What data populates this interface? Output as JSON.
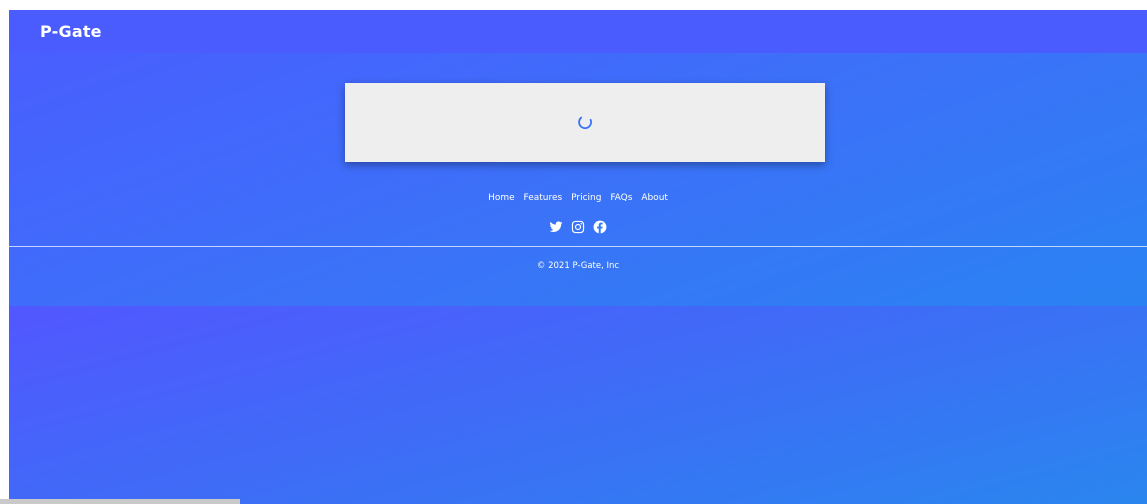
{
  "app": {
    "brand": "P-Gate"
  },
  "footer": {
    "links": [
      {
        "label": "Home"
      },
      {
        "label": "Features"
      },
      {
        "label": "Pricing"
      },
      {
        "label": "FAQs"
      },
      {
        "label": "About"
      }
    ],
    "social": [
      {
        "icon": "twitter-icon"
      },
      {
        "icon": "instagram-icon"
      },
      {
        "icon": "facebook-icon"
      }
    ],
    "copyright": "© 2021 P-Gate, Inc"
  },
  "colors": {
    "primary": "#4b5cff",
    "gradient_end": "#1f8cee",
    "card_bg": "#eeeeee",
    "spinner": "#3a73f8"
  },
  "loading": {
    "icon": "loading-spinner-icon"
  }
}
